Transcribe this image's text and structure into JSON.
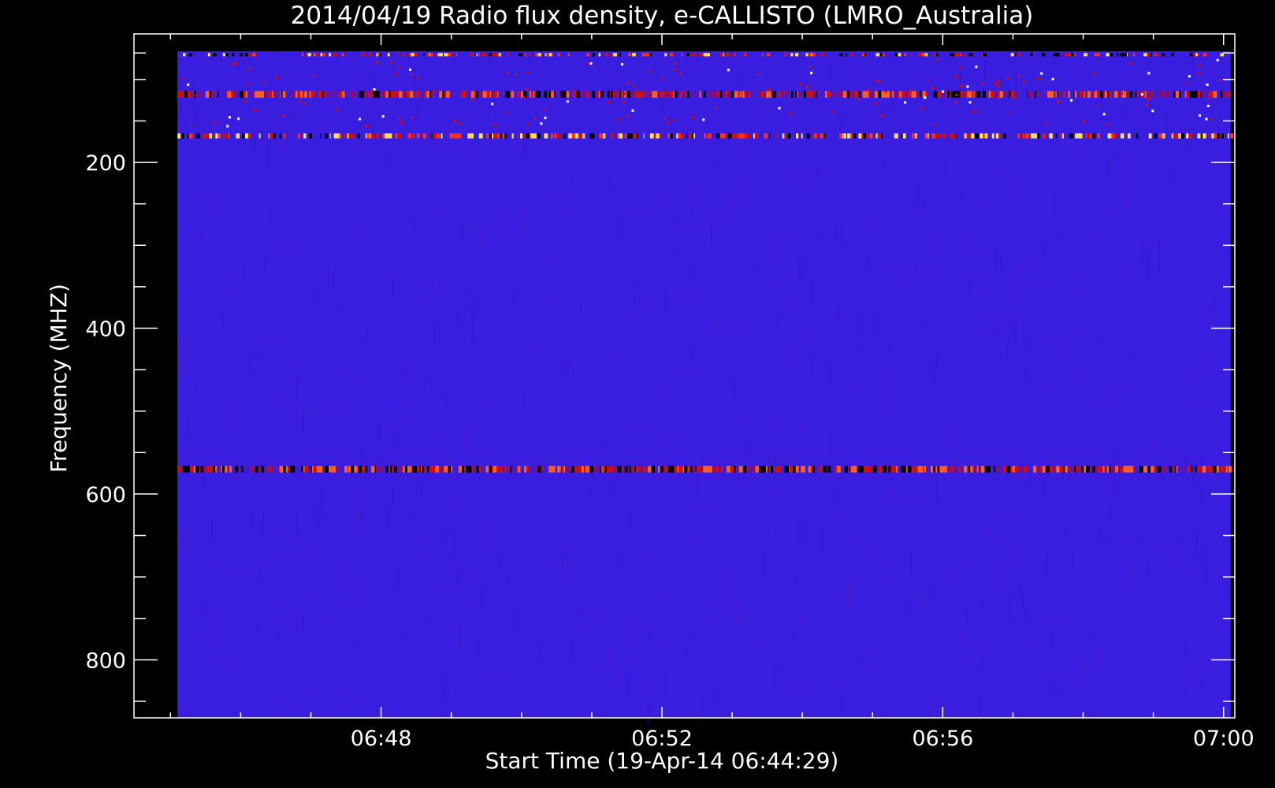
{
  "chart_data": {
    "type": "heatmap",
    "title": "2014/04/19  Radio flux density, e-CALLISTO (LMRO_Australia)",
    "xlabel": "Start Time (19-Apr-14 06:44:29)",
    "ylabel": "Frequency (MHZ)",
    "x_axis": {
      "unit": "minutes after 06:44:29",
      "range": [
        0,
        15.68
      ],
      "data_extent": [
        0.62,
        15.62
      ],
      "ticks": [
        {
          "value": 3.52,
          "label": "06:48"
        },
        {
          "value": 7.52,
          "label": "06:52"
        },
        {
          "value": 11.52,
          "label": "06:56"
        },
        {
          "value": 15.52,
          "label": "07:00"
        }
      ],
      "minor_step": 1.0
    },
    "y_axis": {
      "unit": "MHz",
      "range": [
        45,
        870
      ],
      "data_extent": [
        66,
        870
      ],
      "inverted": true,
      "ticks": [
        {
          "value": 200,
          "label": "200"
        },
        {
          "value": 400,
          "label": "400"
        },
        {
          "value": 600,
          "label": "600"
        },
        {
          "value": 800,
          "label": "800"
        }
      ],
      "minor_step": 50
    },
    "background_color": "#3a1ee0",
    "colors": {
      "low": "#000000",
      "mid": "#d01010",
      "high": "#ffe060",
      "background": "#3a1ee0",
      "axes": "#ffffff"
    },
    "bands": [
      {
        "freq_center": 70,
        "freq_width": 4,
        "intensity": "high",
        "coverage": 0.35
      },
      {
        "freq_center": 118,
        "freq_width": 8,
        "intensity": "mid",
        "coverage": 0.75
      },
      {
        "freq_center": 168,
        "freq_width": 6,
        "intensity": "high",
        "coverage": 0.55
      },
      {
        "freq_center": 570,
        "freq_width": 8,
        "intensity": "mid",
        "coverage": 0.85
      }
    ]
  }
}
